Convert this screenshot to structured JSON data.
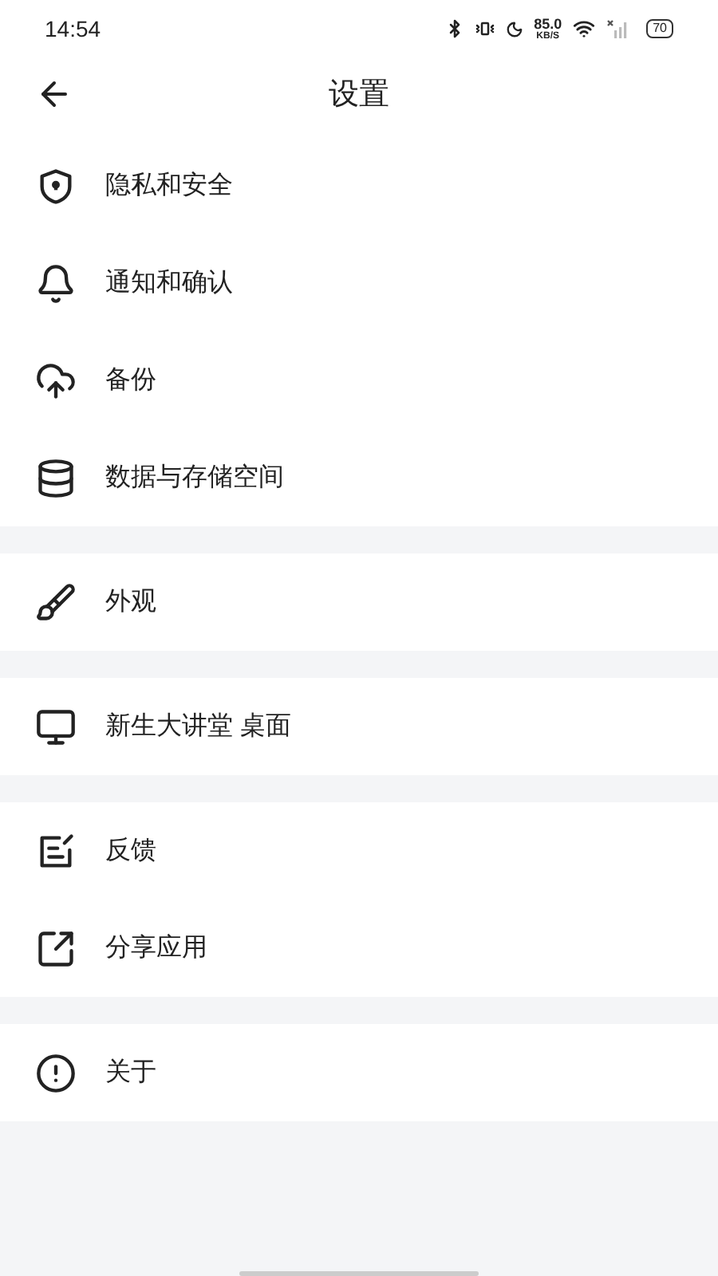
{
  "status_bar": {
    "time": "14:54",
    "speed": "85.0",
    "speed_unit": "KB/S",
    "battery": "70"
  },
  "header": {
    "title": "设置"
  },
  "groups": [
    {
      "items": [
        {
          "label": "隐私和安全"
        },
        {
          "label": "通知和确认"
        },
        {
          "label": "备份"
        },
        {
          "label": "数据与存储空间"
        }
      ]
    },
    {
      "items": [
        {
          "label": "外观"
        }
      ]
    },
    {
      "items": [
        {
          "label": "新生大讲堂 桌面"
        }
      ]
    },
    {
      "items": [
        {
          "label": "反馈"
        },
        {
          "label": "分享应用"
        }
      ]
    },
    {
      "items": [
        {
          "label": "关于"
        }
      ]
    }
  ]
}
